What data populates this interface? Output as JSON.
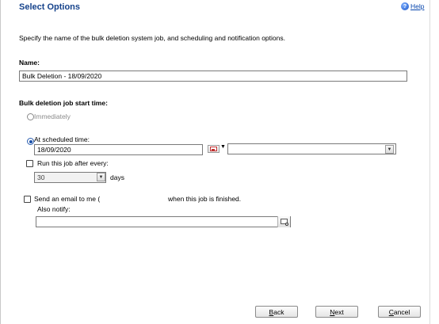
{
  "header": {
    "title": "Select Options",
    "help_label": "Help",
    "help_icon": "help-icon"
  },
  "description": "Specify the name of the bulk deletion system job, and scheduling and notification options.",
  "name_field": {
    "label": "Name:",
    "value": "Bulk Deletion - 18/09/2020"
  },
  "start_time": {
    "label": "Bulk deletion job start time:",
    "immediately_label": "Immediately",
    "immediately_selected": false,
    "scheduled_label": "At scheduled time:",
    "scheduled_selected": true,
    "date_value": "18/09/2020",
    "time_value": ""
  },
  "recurrence": {
    "checkbox_label": "Run this job after every:",
    "checked": false,
    "interval_value": "30",
    "unit_label": "days"
  },
  "notification": {
    "label_prefix": "Send an email to me (",
    "label_suffix": "when this job is finished.",
    "checked": false,
    "also_notify_label": "Also notify:",
    "also_notify_value": ""
  },
  "buttons": {
    "back_u": "B",
    "back_rest": "ack",
    "next_u": "N",
    "next_rest": "ext",
    "cancel_u": "C",
    "cancel_rest": "ancel"
  },
  "colors": {
    "title": "#15428b",
    "radio_selected": "#1a4fa8"
  }
}
